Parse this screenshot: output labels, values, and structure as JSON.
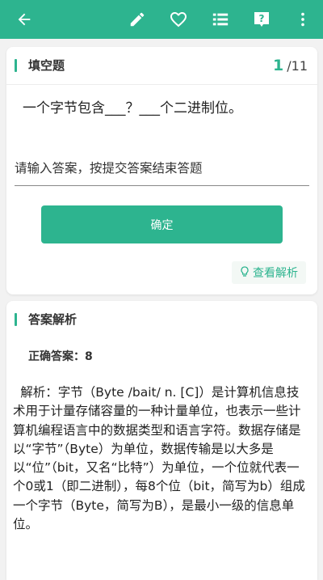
{
  "toolbar": {
    "back_icon": "arrow-left-icon",
    "edit_icon": "pencil-icon",
    "favorite_icon": "heart-icon",
    "list_icon": "list-icon",
    "help_icon": "question-icon",
    "more_icon": "more-vert-icon"
  },
  "colors": {
    "accent": "#2db48f",
    "background": "#f2f2f2",
    "card": "#ffffff"
  },
  "question": {
    "section_title": "填空题",
    "current": "1",
    "total": "/11",
    "text": "一个字节包含___？___个二进制位。",
    "input_placeholder": "请输入答案，按提交答案结束答题",
    "input_value": "",
    "confirm_label": "确定",
    "view_analysis_label": "查看解析"
  },
  "analysis": {
    "section_title": "答案解析",
    "correct_answer": "正确答案：8",
    "text": "解析：字节（Byte /bait/ n. [C]）是计算机信息技术用于计量存储容量的一种计量单位，也表示一些计算机编程语言中的数据类型和语言字符。数据存储是以“字节”（Byte）为单位，数据传输是以大多是以“位”（bit，又名“比特”）为单位，一个位就代表一个0或1（即二进制），每8个位（bit，简写为b）组成一个字节（Byte，简写为B），是最小一级的信息单位。"
  }
}
